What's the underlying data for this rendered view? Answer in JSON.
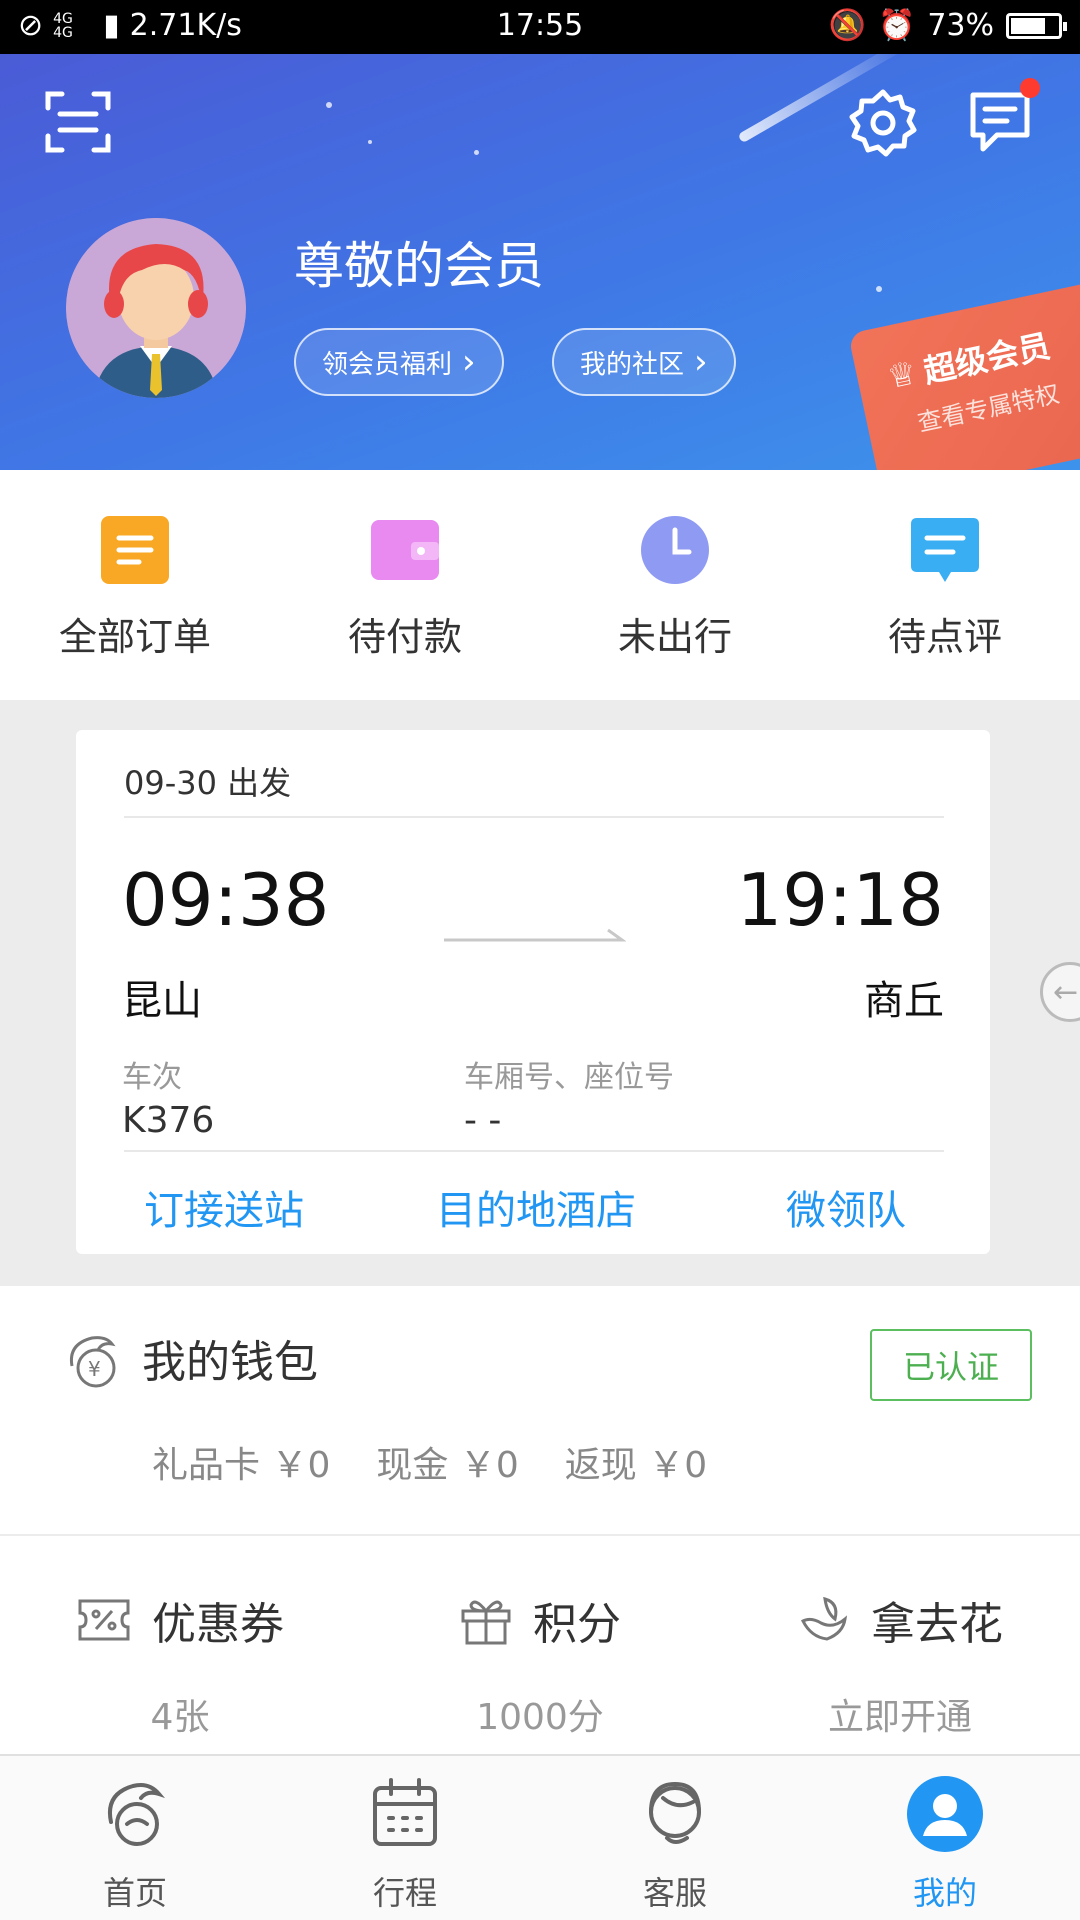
{
  "status_bar": {
    "network": "4G 4G",
    "speed": "2.71K/s",
    "time": "17:55",
    "battery_percent": "73%",
    "battery_level": 0.73
  },
  "header": {
    "username": "尊敬的会员",
    "pills": [
      {
        "label": "领会员福利"
      },
      {
        "label": "我的社区"
      }
    ],
    "vip_card": {
      "title": "超级会员",
      "subtitle": "查看专属特权"
    },
    "has_unread_messages": true
  },
  "orders": [
    {
      "label": "全部订单",
      "icon": "order-list-icon",
      "color": "#f9a825"
    },
    {
      "label": "待付款",
      "icon": "wallet-icon",
      "color": "#e88af0"
    },
    {
      "label": "未出行",
      "icon": "clock-icon",
      "color": "#8f9af3"
    },
    {
      "label": "待点评",
      "icon": "comment-icon",
      "color": "#3aaef2"
    }
  ],
  "trip": {
    "date": "09-30 出发",
    "depart_time": "09:38",
    "arrive_time": "19:18",
    "from": "昆山",
    "to": "商丘",
    "train_label": "车次",
    "train_no": "K376",
    "seat_label": "车厢号、座位号",
    "seat_value": "- -",
    "links": [
      "订接送站",
      "目的地酒店",
      "微领队"
    ]
  },
  "wallet": {
    "title": "我的钱包",
    "verified": "已认证",
    "funds": [
      {
        "label": "礼品卡",
        "value": "￥0"
      },
      {
        "label": "现金",
        "value": "￥0"
      },
      {
        "label": "返现",
        "value": "￥0"
      }
    ]
  },
  "benefits": [
    {
      "name": "优惠券",
      "value": "4张",
      "icon": "coupon-icon"
    },
    {
      "name": "积分",
      "value": "1000分",
      "icon": "gift-icon"
    },
    {
      "name": "拿去花",
      "value": "立即开通",
      "icon": "flower-icon"
    }
  ],
  "bottom_nav": [
    {
      "label": "首页",
      "icon": "home-dolphin-icon",
      "active": false
    },
    {
      "label": "行程",
      "icon": "calendar-icon",
      "active": false
    },
    {
      "label": "客服",
      "icon": "headset-icon",
      "active": false
    },
    {
      "label": "我的",
      "icon": "profile-icon",
      "active": true
    }
  ],
  "colors": {
    "accent": "#2196f3",
    "header_start": "#4a5bd6",
    "header_end": "#3d93ec",
    "verified": "#4caf50",
    "vip": "#ef6e55"
  }
}
